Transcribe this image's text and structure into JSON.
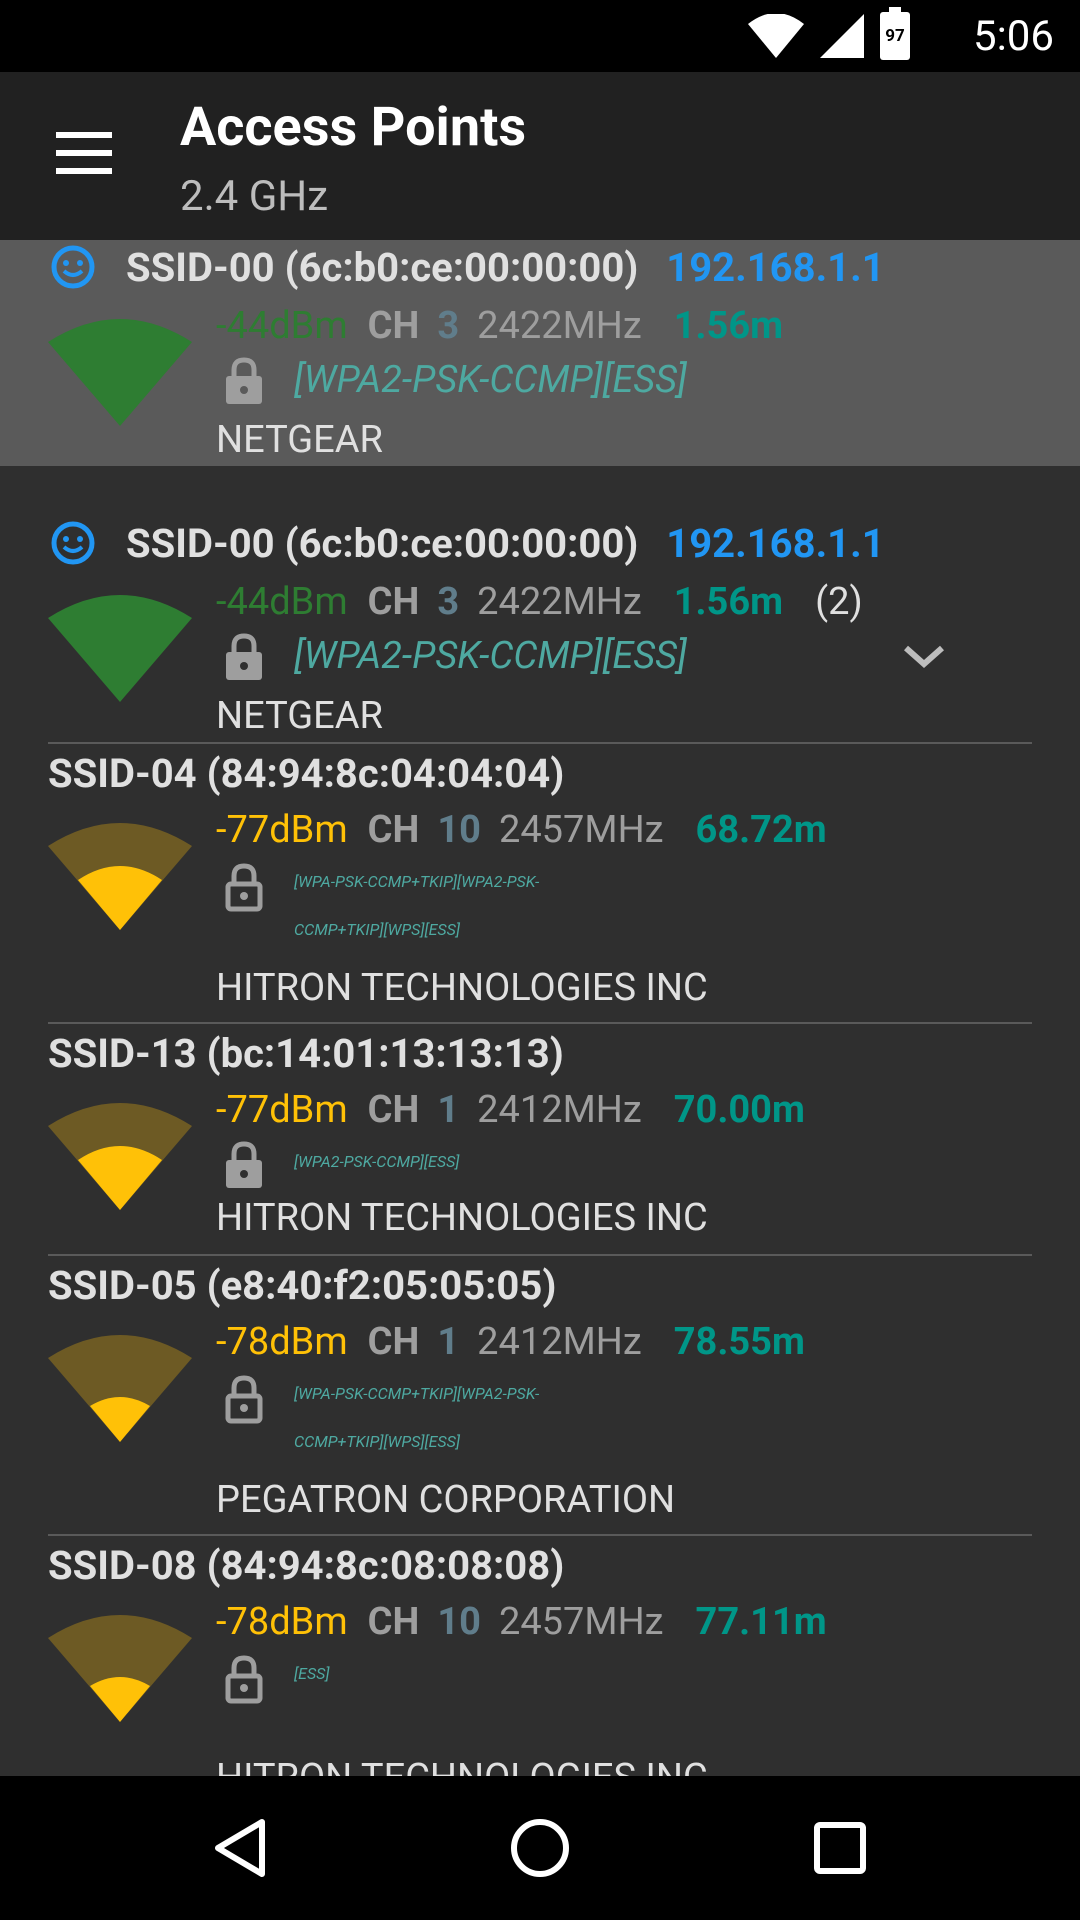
{
  "status_bar": {
    "time": "5:06",
    "battery": "97"
  },
  "app_bar": {
    "title": "Access Points",
    "subtitle": "2.4 GHz"
  },
  "access_points": [
    {
      "ssid": "SSID-00",
      "bssid": "(6c:b0:ce:00:00:00)",
      "ip": "192.168.1.1",
      "level": "-44dBm",
      "ch_label": "CH",
      "channel": "3",
      "freq": "2422MHz",
      "distance": "1.56m",
      "capabilities": "[WPA2-PSK-CCMP][ESS]",
      "vendor": "NETGEAR",
      "connected": true
    },
    {
      "ssid": "SSID-00",
      "bssid": "(6c:b0:ce:00:00:00)",
      "ip": "192.168.1.1",
      "level": "-44dBm",
      "ch_label": "CH",
      "channel": "3",
      "freq": "2422MHz",
      "distance": "1.56m",
      "count": "(2)",
      "capabilities": "[WPA2-PSK-CCMP][ESS]",
      "vendor": "NETGEAR",
      "connected": true
    },
    {
      "ssid": "SSID-04",
      "bssid": "(84:94:8c:04:04:04)",
      "level": "-77dBm",
      "ch_label": "CH",
      "channel": "10",
      "freq": "2457MHz",
      "distance": "68.72m",
      "capabilities_line1": "[WPA-PSK-CCMP+TKIP][WPA2-PSK-",
      "capabilities_line2": "CCMP+TKIP][WPS][ESS]",
      "vendor": "HITRON TECHNOLOGIES INC"
    },
    {
      "ssid": "SSID-13",
      "bssid": "(bc:14:01:13:13:13)",
      "level": "-77dBm",
      "ch_label": "CH",
      "channel": "1",
      "freq": "2412MHz",
      "distance": "70.00m",
      "capabilities": "[WPA2-PSK-CCMP][ESS]",
      "vendor": "HITRON TECHNOLOGIES INC"
    },
    {
      "ssid": "SSID-05",
      "bssid": "(e8:40:f2:05:05:05)",
      "level": "-78dBm",
      "ch_label": "CH",
      "channel": "1",
      "freq": "2412MHz",
      "distance": "78.55m",
      "capabilities_line1": "[WPA-PSK-CCMP+TKIP][WPA2-PSK-",
      "capabilities_line2": "CCMP+TKIP][WPS][ESS]",
      "vendor": "PEGATRON CORPORATION"
    },
    {
      "ssid": "SSID-08",
      "bssid": "(84:94:8c:08:08:08)",
      "level": "-78dBm",
      "ch_label": "CH",
      "channel": "10",
      "freq": "2457MHz",
      "distance": "77.11m",
      "capabilities": "[ESS]",
      "vendor": "HITRON TECHNOLOGIES INC"
    }
  ],
  "colors": {
    "strong": "#2e7d32",
    "weak": "#ffc107",
    "weak_bg": "#6d5a24",
    "ip": "#2196f3",
    "distance": "#009688",
    "capability": "#4ea9a1"
  },
  "icons": {
    "menu": "menu-icon",
    "wifi": "wifi-signal-icon",
    "lock": "lock-icon",
    "connected": "smiley-icon",
    "expand": "chevron-down-icon",
    "back": "back-icon",
    "home": "home-icon",
    "recents": "recents-icon"
  }
}
